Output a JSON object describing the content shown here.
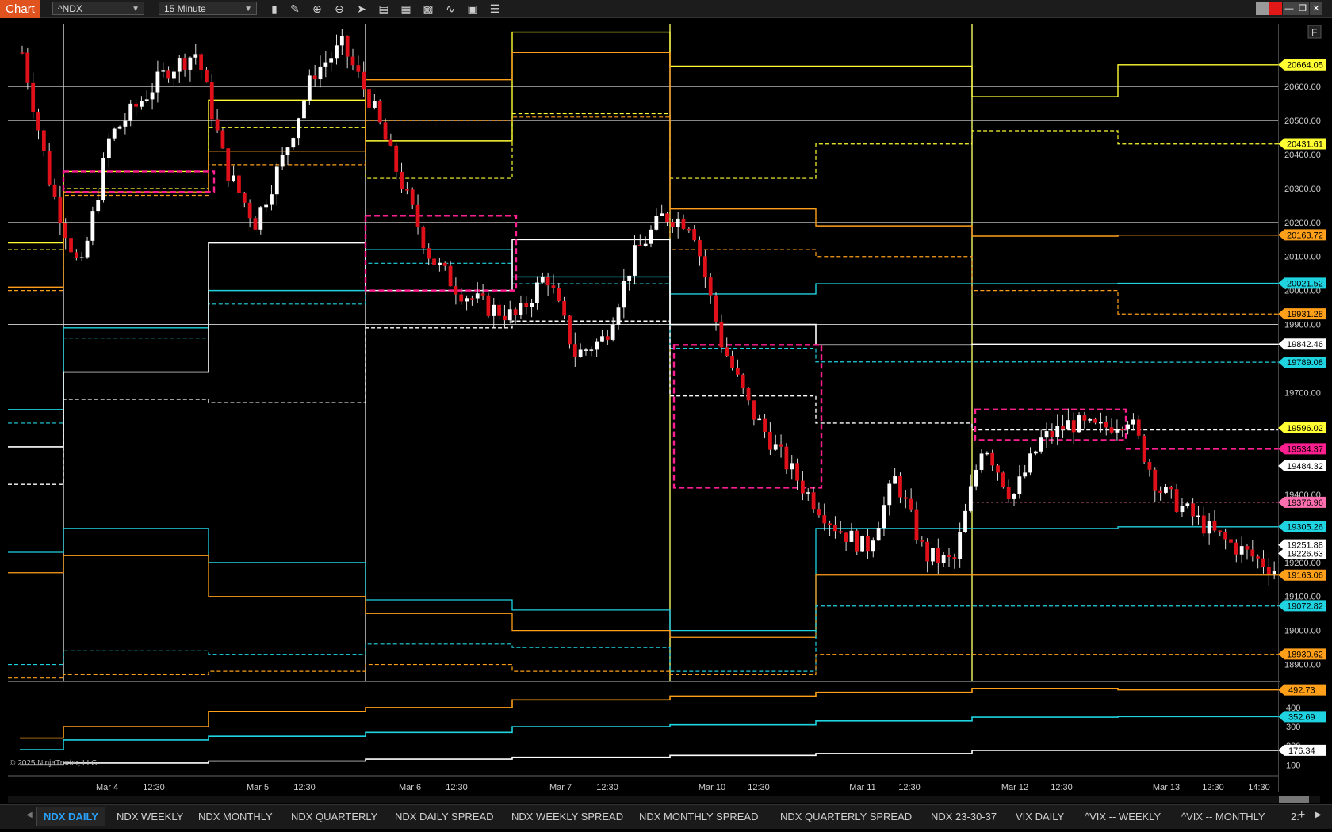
{
  "toolbar": {
    "chart_label": "Chart",
    "instrument": "^NDX",
    "interval": "15 Minute",
    "f_label": "F"
  },
  "icons": [
    "bars-icon",
    "draw-icon",
    "zoom-in-icon",
    "zoom-out-icon",
    "pointer-icon",
    "data-box-icon",
    "properties-icon",
    "templates-icon",
    "indicators-icon",
    "strategies-icon",
    "list-icon"
  ],
  "copyright": "© 2025 NinjaTrader, LLC",
  "price_axis": {
    "ticks": [
      "20600.00",
      "20500.00",
      "20400.00",
      "20300.00",
      "20200.00",
      "20100.00",
      "20000.00",
      "19900.00",
      "19700.00",
      "19400.00",
      "19200.00",
      "19100.00",
      "19000.00",
      "18900.00"
    ],
    "badges": [
      {
        "text": "20664.05",
        "color": "#ffff33"
      },
      {
        "text": "20431.61",
        "color": "#ffff33"
      },
      {
        "text": "20163.72",
        "color": "#ff9f1a"
      },
      {
        "text": "20021.52",
        "color": "#1fd3e0"
      },
      {
        "text": "19931.28",
        "color": "#ff9f1a"
      },
      {
        "text": "19842.46",
        "color": "#ffffff"
      },
      {
        "text": "19789.08",
        "color": "#1fd3e0"
      },
      {
        "text": "19596.02",
        "color": "#ffff33"
      },
      {
        "text": "19534.37",
        "color": "#ff1f8f"
      },
      {
        "text": "19484.32",
        "color": "#ffffff"
      },
      {
        "text": "19376.96",
        "color": "#ff6fb0"
      },
      {
        "text": "19305.26",
        "color": "#1fd3e0"
      },
      {
        "text": "19251.88",
        "color": "#ffffff"
      },
      {
        "text": "19226.63",
        "color": "#ffffff"
      },
      {
        "text": "19163.06",
        "color": "#ff9f1a"
      },
      {
        "text": "19072.82",
        "color": "#1fd3e0"
      },
      {
        "text": "18930.62",
        "color": "#ff9f1a"
      }
    ]
  },
  "lower_axis": {
    "ticks": [
      "400",
      "300",
      "200",
      "100"
    ],
    "badges": [
      {
        "text": "492.73",
        "color": "#ff9f1a"
      },
      {
        "text": "352.69",
        "color": "#1fd3e0"
      },
      {
        "text": "176.34",
        "color": "#ffffff"
      }
    ]
  },
  "time_axis": [
    "Mar 4",
    "12:30",
    "Mar 5",
    "12:30",
    "Mar 6",
    "12:30",
    "Mar 7",
    "12:30",
    "Mar 10",
    "12:30",
    "Mar 11",
    "12:30",
    "Mar 12",
    "12:30",
    "Mar 13",
    "12:30",
    "14:30"
  ],
  "tabs": [
    "NDX DAILY",
    "NDX WEEKLY",
    "NDX MONTHLY",
    "NDX QUARTERLY",
    "NDX DAILY SPREAD",
    "NDX WEEKLY SPREAD",
    "NDX MONTHLY SPREAD",
    "NDX QUARTERLY SPREAD",
    "NDX 23-30-37",
    "VIX DAILY",
    "^VIX -- WEEKLY",
    "^VIX -- MONTHLY",
    "2:"
  ],
  "colors": {
    "up": "#ffffff",
    "down": "#e0101a",
    "yellow": "#ffff33",
    "orange": "#ff9f1a",
    "cyan": "#1fd3e0",
    "magenta": "#ff1f8f",
    "white": "#ffffff"
  },
  "chart_data": {
    "type": "candlestick",
    "instrument": "^NDX",
    "interval": "15 Minute",
    "x": [
      "Mar 4",
      "Mar 5",
      "Mar 6",
      "Mar 7",
      "Mar 10",
      "Mar 11",
      "Mar 12",
      "Mar 13"
    ],
    "approx_close_path": [
      20700,
      20300,
      20050,
      20450,
      20550,
      20650,
      20700,
      20360,
      20200,
      20400,
      20640,
      20720,
      20550,
      20320,
      20100,
      20000,
      19950,
      19920,
      20050,
      19810,
      19860,
      20100,
      20220,
      20200,
      19850,
      19650,
      19520,
      19400,
      19300,
      19240,
      19450,
      19220,
      19200,
      19560,
      19390,
      19560,
      19610,
      19590,
      19630,
      19420,
      19350,
      19280,
      19230,
      19180
    ],
    "ylim": [
      18850,
      20780
    ],
    "levels": [
      20664.05,
      20431.61,
      20163.72,
      20021.52,
      19931.28,
      19842.46,
      19789.08,
      19596.02,
      19534.37,
      19484.32,
      19376.96,
      19305.26,
      19251.88,
      19226.63,
      19163.06,
      19072.82,
      18930.62
    ],
    "lower_panel": {
      "series_last_values": [
        492.73,
        352.69,
        176.34
      ],
      "ylim": [
        60,
        520
      ]
    }
  }
}
